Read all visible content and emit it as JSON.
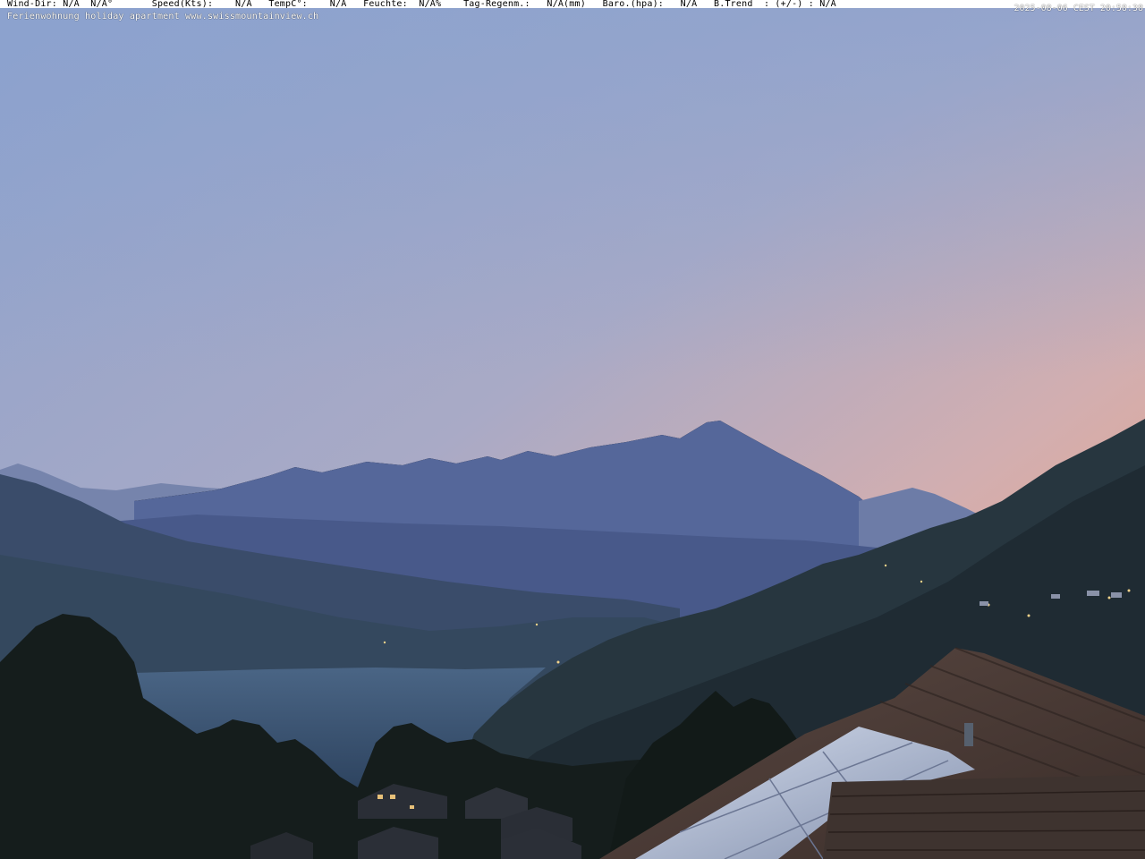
{
  "overlay": {
    "weather_line": "Wind-Dir: N/A  N/A°       Speed(Kts):    N/A   TempC°:    N/A   Feuchte:  N/A%    Tag-Regenm.:   N/A(mm)   Baro.(hpa):   N/A   B.Trend  : (+/-) : N/A",
    "timestamp": "2025-08-06 CEST 20:58:38",
    "caption": "Ferienwohnung holiday apartment www.swissmountainview.ch"
  },
  "scene": {
    "description_icons": [
      "mountain-ridge",
      "lake",
      "trees",
      "roof",
      "solar-panels"
    ],
    "colors": {
      "sky_top": "#8fa6cf",
      "sky_mid": "#b7b2c4",
      "sky_horizon": "#f0a27e",
      "far_ridge": "#56689a",
      "mid_ridge": "#44577f",
      "near_hill": "#2b3b4b",
      "lake": "#3d5675",
      "forest": "#141d1a",
      "roof": "#4a3b36",
      "solar": "#b4bfd6"
    }
  }
}
